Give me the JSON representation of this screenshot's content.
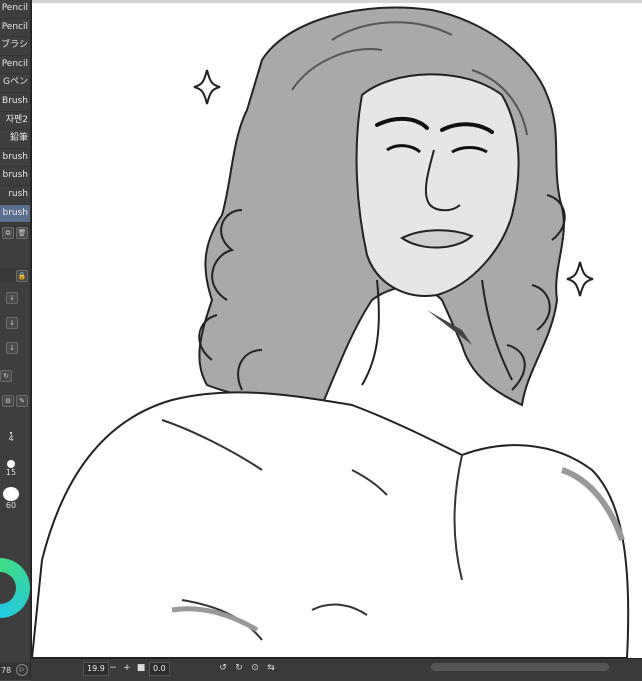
{
  "brush_panel": {
    "items": [
      {
        "label": "Pencil",
        "selected": false
      },
      {
        "label": "Pencil",
        "selected": false
      },
      {
        "label": "ブラシ",
        "selected": false
      },
      {
        "label": "Pencil",
        "selected": false
      },
      {
        "label": "Gペン",
        "selected": false
      },
      {
        "label": "Brush",
        "selected": false
      },
      {
        "label": "자펜2",
        "selected": false
      },
      {
        "label": "鉛筆",
        "selected": false
      },
      {
        "label": "brush",
        "selected": false
      },
      {
        "label": "brush",
        "selected": false
      },
      {
        "label": "rush",
        "selected": false
      },
      {
        "label": "brush",
        "selected": true
      }
    ]
  },
  "brush_sizes": [
    {
      "label": "4"
    },
    {
      "label": "15"
    },
    {
      "label": "60"
    }
  ],
  "footer_left": {
    "value": "78"
  },
  "status_bar": {
    "zoom": "19.9",
    "minus": "−",
    "plus": "+",
    "angle": "0.0"
  },
  "colors": {
    "panel_bg": "#3e3e3e",
    "selected": "#5b6f8e",
    "accent_wheel": "#3fdc84",
    "canvas": "#ffffff"
  }
}
